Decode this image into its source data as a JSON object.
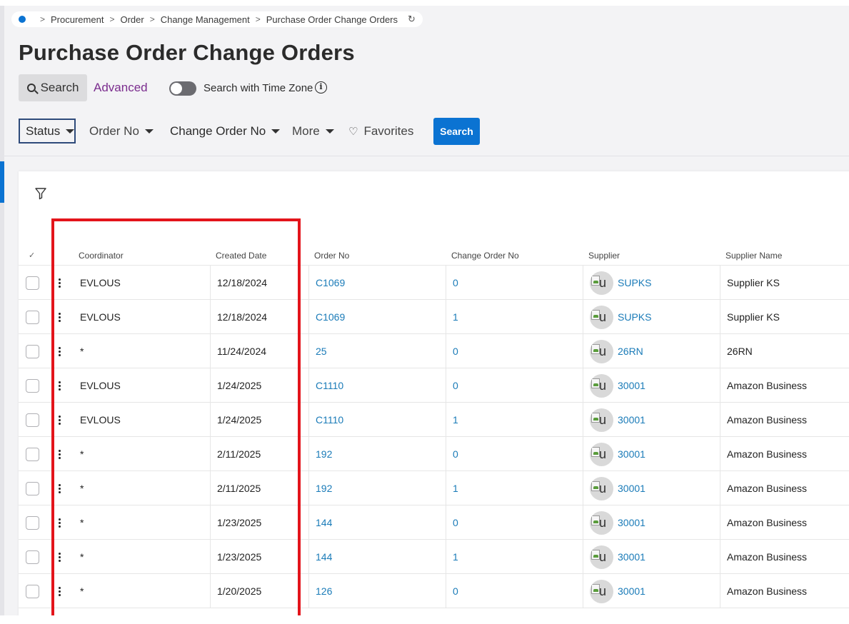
{
  "breadcrumb": {
    "items": [
      "Procurement",
      "Order",
      "Change Management",
      "Purchase Order Change Orders"
    ]
  },
  "page_title": "Purchase Order Change Orders",
  "search_tabs": {
    "search": "Search",
    "advanced": "Advanced"
  },
  "time_zone": {
    "label": "Search with Time Zone",
    "enabled": false
  },
  "filters": {
    "status": "Status",
    "order_no": "Order No",
    "change_order_no": "Change Order No",
    "more": "More",
    "favorites": "Favorites",
    "search_button": "Search"
  },
  "colors": {
    "accent": "#0b73d2",
    "link": "#1a7bb8",
    "advanced": "#7b2d8e",
    "highlight": "#e3141b"
  },
  "grid": {
    "columns": [
      "Coordinator",
      "Created Date",
      "Order No",
      "Change Order No",
      "Supplier",
      "Supplier Name"
    ],
    "rows": [
      {
        "coordinator": "EVLOUS",
        "created": "12/18/2024",
        "order_no": "C1069",
        "change_no": "0",
        "supplier": "SUPKS",
        "supplier_name": "Supplier KS"
      },
      {
        "coordinator": "EVLOUS",
        "created": "12/18/2024",
        "order_no": "C1069",
        "change_no": "1",
        "supplier": "SUPKS",
        "supplier_name": "Supplier KS"
      },
      {
        "coordinator": "*",
        "created": "11/24/2024",
        "order_no": "25",
        "change_no": "0",
        "supplier": "26RN",
        "supplier_name": "26RN"
      },
      {
        "coordinator": "EVLOUS",
        "created": "1/24/2025",
        "order_no": "C1110",
        "change_no": "0",
        "supplier": "30001",
        "supplier_name": "Amazon Business"
      },
      {
        "coordinator": "EVLOUS",
        "created": "1/24/2025",
        "order_no": "C1110",
        "change_no": "1",
        "supplier": "30001",
        "supplier_name": "Amazon Business"
      },
      {
        "coordinator": "*",
        "created": "2/11/2025",
        "order_no": "192",
        "change_no": "0",
        "supplier": "30001",
        "supplier_name": "Amazon Business"
      },
      {
        "coordinator": "*",
        "created": "2/11/2025",
        "order_no": "192",
        "change_no": "1",
        "supplier": "30001",
        "supplier_name": "Amazon Business"
      },
      {
        "coordinator": "*",
        "created": "1/23/2025",
        "order_no": "144",
        "change_no": "0",
        "supplier": "30001",
        "supplier_name": "Amazon Business"
      },
      {
        "coordinator": "*",
        "created": "1/23/2025",
        "order_no": "144",
        "change_no": "1",
        "supplier": "30001",
        "supplier_name": "Amazon Business"
      },
      {
        "coordinator": "*",
        "created": "1/20/2025",
        "order_no": "126",
        "change_no": "0",
        "supplier": "30001",
        "supplier_name": "Amazon Business"
      }
    ]
  }
}
